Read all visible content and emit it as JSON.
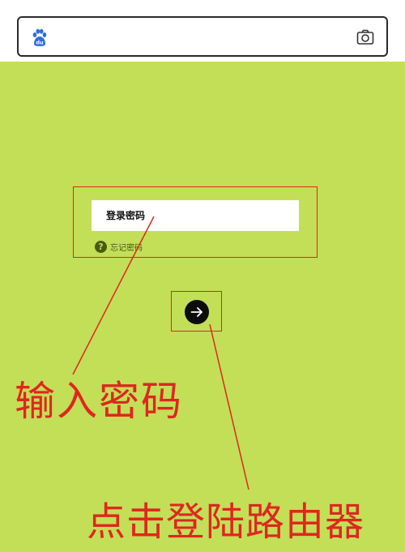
{
  "search": {
    "logo_text": "du"
  },
  "login": {
    "password_placeholder": "登录密码",
    "forgot_label": "忘记密码",
    "help_glyph": "?"
  },
  "annotations": {
    "caption_1": "输入密码",
    "caption_2": "点击登陆路由器"
  },
  "colors": {
    "background_green": "#c2df57",
    "annotation_red": "#e0261f",
    "baidu_blue": "#2f6de0"
  }
}
